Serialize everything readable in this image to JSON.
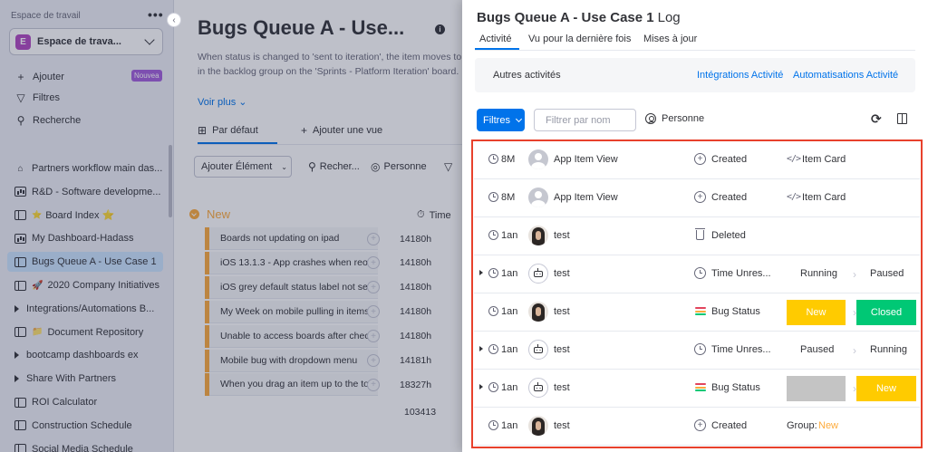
{
  "sidebar": {
    "workspace_label": "Espace de travail",
    "more_label": "•••",
    "collapse_glyph": "‹",
    "workspace_initial": "E",
    "workspace_name": "Espace de trava...",
    "actions": [
      {
        "icon": "plus-icon",
        "glyph": "+",
        "label": "Ajouter"
      },
      {
        "icon": "filter-icon",
        "glyph": "▽",
        "label": "Filtres"
      },
      {
        "icon": "search-icon",
        "glyph": "⚲",
        "label": "Recherche"
      }
    ],
    "new_badge": "Nouvea",
    "items": [
      {
        "icon": "home-icon",
        "glyph": "⌂",
        "label": "Partners workflow main das..."
      },
      {
        "icon": "dashboard-icon",
        "label": "R&D - Software developme..."
      },
      {
        "icon": "board-icon",
        "prefix": "⭐",
        "label": "Board Index ⭐"
      },
      {
        "icon": "dashboard-icon",
        "label": "My Dashboard-Hadass"
      },
      {
        "icon": "board-icon",
        "label": "Bugs Queue A - Use Case 1",
        "active": true
      },
      {
        "icon": "board-icon",
        "prefix": "🚀",
        "label": "2020 Company Initiatives"
      },
      {
        "icon": "folder-arrow",
        "label": "Integrations/Automations B..."
      },
      {
        "icon": "board-icon",
        "prefix": "📁",
        "label": "Document Repository"
      },
      {
        "icon": "folder-arrow",
        "label": "bootcamp dashboards ex"
      },
      {
        "icon": "folder-arrow",
        "label": "Share With Partners"
      },
      {
        "icon": "board-icon",
        "label": "ROI Calculator"
      },
      {
        "icon": "board-icon",
        "label": "Construction Schedule"
      },
      {
        "icon": "board-icon",
        "label": "Social Media Schedule"
      }
    ]
  },
  "board": {
    "title": "Bugs Queue A - Use...",
    "info_glyph": "i",
    "desc_line1": "When status is changed to 'sent to iteration', the item moves to",
    "desc_line2": "in the backlog group on the 'Sprints - Platform Iteration' board.",
    "voir_plus": "Voir plus ⌄",
    "views": [
      {
        "icon": "table-icon",
        "glyph": "⊞",
        "label": "Par défaut"
      },
      {
        "icon": "plus-icon",
        "glyph": "+",
        "label": "Ajouter une vue"
      }
    ],
    "add_item": "Ajouter Élément",
    "add_item_chevron": "⌄",
    "tools": [
      {
        "icon": "search-icon",
        "glyph": "⚲",
        "label": "Recher..."
      },
      {
        "icon": "person-icon",
        "glyph": "◎",
        "label": "Personne"
      },
      {
        "icon": "filter-icon",
        "glyph": "▽",
        "label": ""
      }
    ],
    "group_name": "New",
    "time_col": "Time",
    "time_col_glyph": "⏱",
    "row_plus_glyph": "+",
    "rows": [
      {
        "name": "Boards not updating on ipad",
        "value": "14180h"
      },
      {
        "name": "iOS 13.1.3 - App crashes when reorder...",
        "value": "14180h"
      },
      {
        "name": "iOS grey default status label not select...",
        "value": "14180h"
      },
      {
        "name": "My Week on mobile pulling in items th...",
        "value": "14180h"
      },
      {
        "name": "Unable to access boards after checkin...",
        "value": "14180h"
      },
      {
        "name": "Mobile bug with dropdown menu",
        "value": "14181h"
      },
      {
        "name": "When you drag an item up to the top o...",
        "value": "18327h"
      }
    ],
    "total": "103413"
  },
  "panel": {
    "title": "Bugs Queue A - Use Case 1",
    "log_word": "Log",
    "tabs": [
      "Activité",
      "Vu pour la dernière fois",
      "Mises à jour"
    ],
    "sub_activity": "Autres activités",
    "link_integrations": "Intégrations Activité",
    "link_automations": "Automatisations Activité",
    "filters_label": "Filtres",
    "filter_placeholder": "Filtrer par nom",
    "person_label": "Personne",
    "refresh_glyph": "⟳",
    "code_glyph": "</>",
    "arrow_glyph": "›",
    "created_glyph": "+",
    "status_colors": [
      "#e2445c",
      "#fdab3d",
      "#00c875"
    ],
    "colors": {
      "status_new": "#ffcb00",
      "status_closed": "#00c875",
      "status_empty": "#c4c4c4",
      "accent": "#0073ea",
      "highlight_border": "#e8412c"
    },
    "log_rows": [
      {
        "expand": false,
        "age": "8M",
        "avatar": "gray",
        "user": "App Item View",
        "action_icon": "created",
        "action": "Created",
        "kind": "code",
        "detail": "Item Card"
      },
      {
        "expand": false,
        "age": "8M",
        "avatar": "gray",
        "user": "App Item View",
        "action_icon": "created",
        "action": "Created",
        "kind": "code",
        "detail": "Item Card"
      },
      {
        "expand": false,
        "age": "1an",
        "avatar": "photo",
        "user": "test",
        "action_icon": "trash",
        "action": "Deleted",
        "kind": "none"
      },
      {
        "expand": true,
        "age": "1an",
        "avatar": "bot",
        "user": "test",
        "action_icon": "timer",
        "action": "Time Unres...",
        "kind": "text",
        "from": "Running",
        "to": "Paused"
      },
      {
        "expand": false,
        "age": "1an",
        "avatar": "photo",
        "user": "test",
        "action_icon": "status",
        "action": "Bug Status",
        "kind": "status",
        "from": "New",
        "from_color": "#ffcb00",
        "to": "Closed",
        "to_color": "#00c875"
      },
      {
        "expand": true,
        "age": "1an",
        "avatar": "bot",
        "user": "test",
        "action_icon": "timer",
        "action": "Time Unres...",
        "kind": "text",
        "from": "Paused",
        "to": "Running"
      },
      {
        "expand": true,
        "age": "1an",
        "avatar": "bot",
        "user": "test",
        "action_icon": "status",
        "action": "Bug Status",
        "kind": "status",
        "from": "",
        "from_color": "#c4c4c4",
        "to": "New",
        "to_color": "#ffcb00"
      },
      {
        "expand": false,
        "age": "1an",
        "avatar": "photo",
        "user": "test",
        "action_icon": "created",
        "action": "Created",
        "kind": "group",
        "group_label": "Group:",
        "group_value": "New"
      }
    ]
  }
}
